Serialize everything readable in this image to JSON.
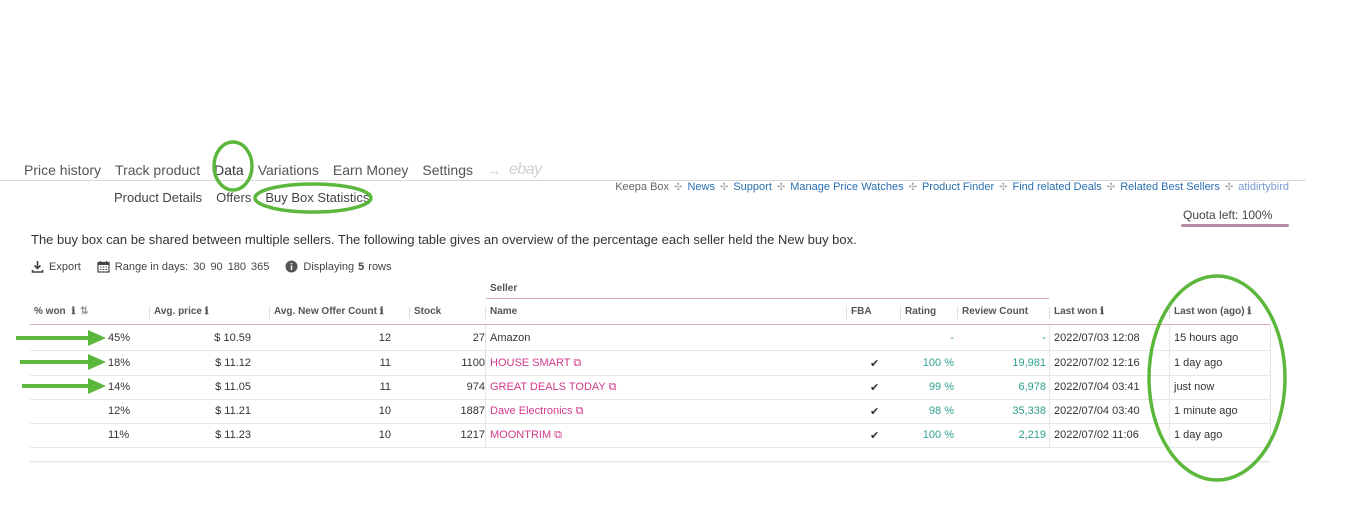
{
  "tabs": [
    "Price history",
    "Track product",
    "Data",
    "Variations",
    "Earn Money",
    "Settings"
  ],
  "tab_arrow": "→",
  "tab_ebay": "ebay",
  "subtabs": [
    "Product Details",
    "Offers",
    "Buy Box Statistics"
  ],
  "links": {
    "keepa_box": "Keepa Box",
    "news": "News",
    "support": "Support",
    "manage": "Manage Price Watches",
    "finder": "Product Finder",
    "deals": "Find related Deals",
    "best": "Related Best Sellers",
    "user": "atidirtybird"
  },
  "quota": "Quota left: 100%",
  "description": "The buy box can be shared between multiple sellers. The following table gives an overview of the percentage each seller held the New buy box.",
  "toolbar": {
    "export": "Export",
    "range_label": "Range in days:",
    "range_options": [
      "30",
      "90",
      "180",
      "365"
    ],
    "displaying_label": "Displaying",
    "displaying_count": "5",
    "displaying_suffix": "rows"
  },
  "table": {
    "seller_group": "Seller",
    "headers": {
      "won": "% won",
      "avg_price": "Avg. price",
      "offer_count": "Avg. New Offer Count",
      "stock": "Stock",
      "name": "Name",
      "fba": "FBA",
      "rating": "Rating",
      "reviews": "Review Count",
      "last_won": "Last won",
      "last_won_ago": "Last won (ago)"
    },
    "rows": [
      {
        "won": "45%",
        "price": "$ 10.59",
        "offers": "12",
        "stock": "27",
        "name": "Amazon",
        "fba": "",
        "rating": "-",
        "reviews": "-",
        "last_won": "2022/07/03 12:08",
        "ago": "15 hours ago"
      },
      {
        "won": "18%",
        "price": "$ 11.12",
        "offers": "11",
        "stock": "1100",
        "name": "HOUSE SMART",
        "fba": "✔",
        "rating": "100 %",
        "reviews": "19,981",
        "last_won": "2022/07/02 12:16",
        "ago": "1 day ago"
      },
      {
        "won": "14%",
        "price": "$ 11.05",
        "offers": "11",
        "stock": "974",
        "name": "GREAT DEALS TODAY",
        "fba": "✔",
        "rating": "99 %",
        "reviews": "6,978",
        "last_won": "2022/07/04 03:41",
        "ago": "just now"
      },
      {
        "won": "12%",
        "price": "$ 11.21",
        "offers": "10",
        "stock": "1887",
        "name": "Dave Electronics",
        "fba": "✔",
        "rating": "98 %",
        "reviews": "35,338",
        "last_won": "2022/07/04 03:40",
        "ago": "1 minute ago"
      },
      {
        "won": "11%",
        "price": "$ 11.23",
        "offers": "10",
        "stock": "1217",
        "name": "MOONTRIM",
        "fba": "✔",
        "rating": "100 %",
        "reviews": "2,219",
        "last_won": "2022/07/02 11:06",
        "ago": "1 day ago"
      }
    ]
  },
  "colors": {
    "annotation_green": "#5cb83c",
    "seller_link": "#d03a8a",
    "teal": "#2e9e8e",
    "link_blue": "#2a6fb0",
    "quota_underline": "#b98ba7"
  }
}
